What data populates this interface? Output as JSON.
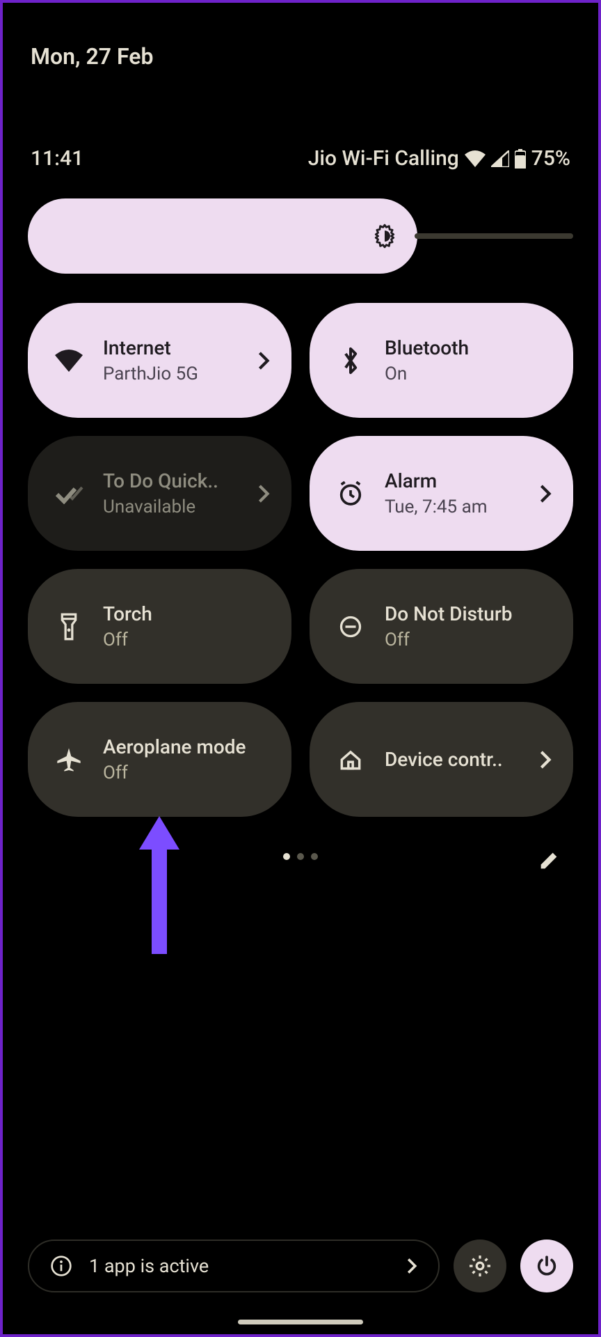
{
  "date": "Mon, 27 Feb",
  "time": "11:41",
  "status": {
    "network_label": "Jio Wi-Fi Calling",
    "battery_pct": "75%"
  },
  "brightness": {
    "value_pct": 70
  },
  "tiles": [
    {
      "id": "internet",
      "title": "Internet",
      "sub": "ParthJio 5G",
      "state": "active",
      "chevron": true
    },
    {
      "id": "bluetooth",
      "title": "Bluetooth",
      "sub": "On",
      "state": "active",
      "chevron": false
    },
    {
      "id": "todo",
      "title": "To Do Quick..",
      "sub": "Unavailable",
      "state": "dim",
      "chevron": true
    },
    {
      "id": "alarm",
      "title": "Alarm",
      "sub": "Tue, 7:45 am",
      "state": "active",
      "chevron": true
    },
    {
      "id": "torch",
      "title": "Torch",
      "sub": "Off",
      "state": "inactive",
      "chevron": false
    },
    {
      "id": "dnd",
      "title": "Do Not Disturb",
      "sub": "Off",
      "state": "inactive",
      "chevron": false
    },
    {
      "id": "airplane",
      "title": "Aeroplane mode",
      "sub": "Off",
      "state": "inactive",
      "chevron": false
    },
    {
      "id": "device",
      "title": "Device contr..",
      "sub": "",
      "state": "inactive",
      "chevron": true
    }
  ],
  "footer": {
    "active_app": "1 app is active"
  },
  "colors": {
    "accent": "#eedcf0",
    "tile_off": "#32302a",
    "annotation": "#7c4dff"
  }
}
